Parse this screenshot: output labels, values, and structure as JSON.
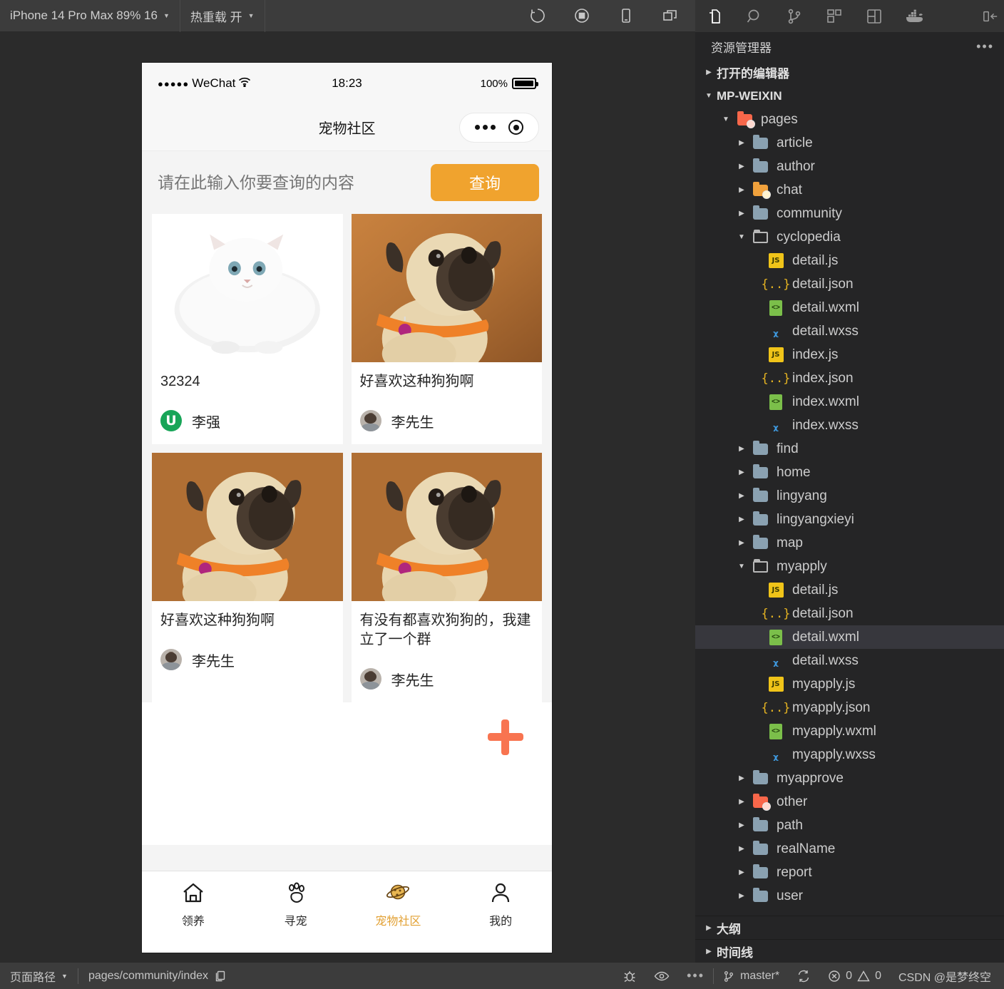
{
  "simulator_toolbar": {
    "device": "iPhone 14 Pro Max 89% 16",
    "hot_reload": "热重载 开",
    "icons": [
      "refresh-icon",
      "stop-record-icon",
      "device-icon",
      "windows-icon"
    ]
  },
  "phone": {
    "status": {
      "carrier": "WeChat",
      "signal_dots": "●●●●●",
      "time": "18:23",
      "battery_percent": "100%"
    },
    "nav": {
      "title": "宠物社区"
    },
    "search": {
      "placeholder": "请在此输入你要查询的内容",
      "value": "",
      "button": "查询",
      "button_color": "#F0A32E"
    },
    "cards": [
      {
        "title": "32324",
        "author": "李强",
        "avatar": "green-letter-avatar",
        "avatar_letter": "U",
        "image": "white-persian-cat"
      },
      {
        "title": "好喜欢这种狗狗啊",
        "author": "李先生",
        "avatar": "photo-avatar",
        "image": "pug-dog"
      },
      {
        "title": "好喜欢这种狗狗啊",
        "author": "李先生",
        "avatar": "photo-avatar",
        "image": "pug-dog"
      },
      {
        "title": "有没有都喜欢狗狗的，我建立了一个群",
        "author": "李先生",
        "avatar": "photo-avatar",
        "image": "pug-dog"
      }
    ],
    "fab": {
      "name": "add-post-button",
      "color": "#F87450"
    },
    "tabs": [
      {
        "label": "领养",
        "icon": "home-icon",
        "active": false
      },
      {
        "label": "寻宠",
        "icon": "paw-icon",
        "active": false
      },
      {
        "label": "宠物社区",
        "icon": "planet-icon",
        "active": true
      },
      {
        "label": "我的",
        "icon": "person-icon",
        "active": false
      }
    ],
    "active_tab_color": "#E2A032"
  },
  "vscode": {
    "activity_icons": [
      "files-icon",
      "search-icon",
      "source-control-icon",
      "extensions-icon",
      "layout-icon",
      "docker-icon",
      "panel-toggle-icon"
    ],
    "explorer_title": "资源管理器",
    "sections": {
      "open_editors": "打开的编辑器",
      "project": "MP-WEIXIN",
      "outline": "大纲",
      "timeline": "时间线"
    },
    "tree": [
      {
        "label": "pages",
        "type": "folder-open-red",
        "depth": 1,
        "expanded": true
      },
      {
        "label": "article",
        "type": "folder",
        "depth": 2,
        "expanded": false
      },
      {
        "label": "author",
        "type": "folder",
        "depth": 2,
        "expanded": false
      },
      {
        "label": "chat",
        "type": "folder-orange",
        "depth": 2,
        "expanded": false
      },
      {
        "label": "community",
        "type": "folder",
        "depth": 2,
        "expanded": false
      },
      {
        "label": "cyclopedia",
        "type": "folder-open",
        "depth": 2,
        "expanded": true
      },
      {
        "label": "detail.js",
        "type": "js",
        "depth": 3
      },
      {
        "label": "detail.json",
        "type": "json",
        "depth": 3
      },
      {
        "label": "detail.wxml",
        "type": "wxml",
        "depth": 3
      },
      {
        "label": "detail.wxss",
        "type": "wxss",
        "depth": 3
      },
      {
        "label": "index.js",
        "type": "js",
        "depth": 3
      },
      {
        "label": "index.json",
        "type": "json",
        "depth": 3
      },
      {
        "label": "index.wxml",
        "type": "wxml",
        "depth": 3
      },
      {
        "label": "index.wxss",
        "type": "wxss",
        "depth": 3
      },
      {
        "label": "find",
        "type": "folder",
        "depth": 2,
        "expanded": false
      },
      {
        "label": "home",
        "type": "folder",
        "depth": 2,
        "expanded": false
      },
      {
        "label": "lingyang",
        "type": "folder",
        "depth": 2,
        "expanded": false
      },
      {
        "label": "lingyangxieyi",
        "type": "folder",
        "depth": 2,
        "expanded": false
      },
      {
        "label": "map",
        "type": "folder",
        "depth": 2,
        "expanded": false
      },
      {
        "label": "myapply",
        "type": "folder-open",
        "depth": 2,
        "expanded": true
      },
      {
        "label": "detail.js",
        "type": "js",
        "depth": 3
      },
      {
        "label": "detail.json",
        "type": "json",
        "depth": 3
      },
      {
        "label": "detail.wxml",
        "type": "wxml",
        "depth": 3,
        "selected": true
      },
      {
        "label": "detail.wxss",
        "type": "wxss",
        "depth": 3
      },
      {
        "label": "myapply.js",
        "type": "js",
        "depth": 3
      },
      {
        "label": "myapply.json",
        "type": "json",
        "depth": 3
      },
      {
        "label": "myapply.wxml",
        "type": "wxml",
        "depth": 3
      },
      {
        "label": "myapply.wxss",
        "type": "wxss",
        "depth": 3
      },
      {
        "label": "myapprove",
        "type": "folder",
        "depth": 2,
        "expanded": false
      },
      {
        "label": "other",
        "type": "folder-red",
        "depth": 2,
        "expanded": false
      },
      {
        "label": "path",
        "type": "folder",
        "depth": 2,
        "expanded": false
      },
      {
        "label": "realName",
        "type": "folder",
        "depth": 2,
        "expanded": false
      },
      {
        "label": "report",
        "type": "folder",
        "depth": 2,
        "expanded": false
      },
      {
        "label": "user",
        "type": "folder",
        "depth": 2,
        "expanded": false
      }
    ]
  },
  "statusbar": {
    "page_path_label": "页面路径",
    "page_path_value": "pages/community/index",
    "copy_icon": "copy-icon",
    "debug_icon": "bug-icon",
    "eye_icon": "eye-icon",
    "more_icon": "more-icon",
    "branch": "master*",
    "sync_icon": "sync-icon",
    "errors": "0",
    "warnings": "0",
    "watermark": "CSDN @是梦终空"
  }
}
